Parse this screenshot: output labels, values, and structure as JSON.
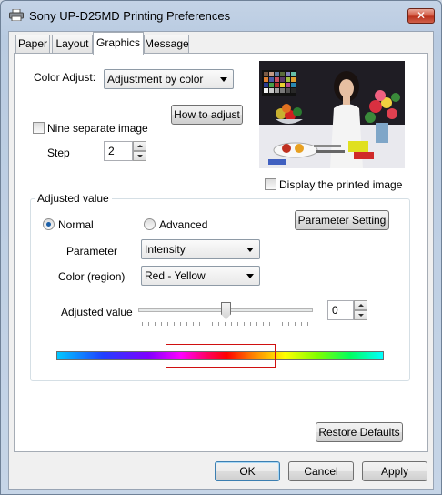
{
  "window": {
    "title": "Sony UP-D25MD Printing Preferences",
    "close_glyph": "✕"
  },
  "tabs": [
    {
      "label": "Paper"
    },
    {
      "label": "Layout"
    },
    {
      "label": "Graphics",
      "active": true
    },
    {
      "label": "Message"
    }
  ],
  "color_adjust": {
    "label": "Color Adjust:",
    "value": "Adjustment by color"
  },
  "how_to_adjust": "How to adjust",
  "nine_separate": {
    "label": "Nine separate image",
    "checked": false
  },
  "step": {
    "label": "Step",
    "value": "2"
  },
  "display_printed": {
    "label": "Display the printed image",
    "checked": false
  },
  "adjusted_group": {
    "title": "Adjusted value",
    "normal_label": "Normal",
    "advanced_label": "Advanced",
    "selected_mode": "Normal",
    "parameter_setting": "Parameter Setting",
    "parameter": {
      "label": "Parameter",
      "value": "Intensity"
    },
    "color_region": {
      "label": "Color (region)",
      "value": "Red - Yellow"
    },
    "adjusted_value": {
      "label": "Adjusted value",
      "value": "0"
    }
  },
  "restore_defaults": "Restore Defaults",
  "footer": {
    "ok": "OK",
    "cancel": "Cancel",
    "apply": "Apply"
  },
  "icons": {
    "app": "printer-icon",
    "preview": "sample-photo-image"
  }
}
